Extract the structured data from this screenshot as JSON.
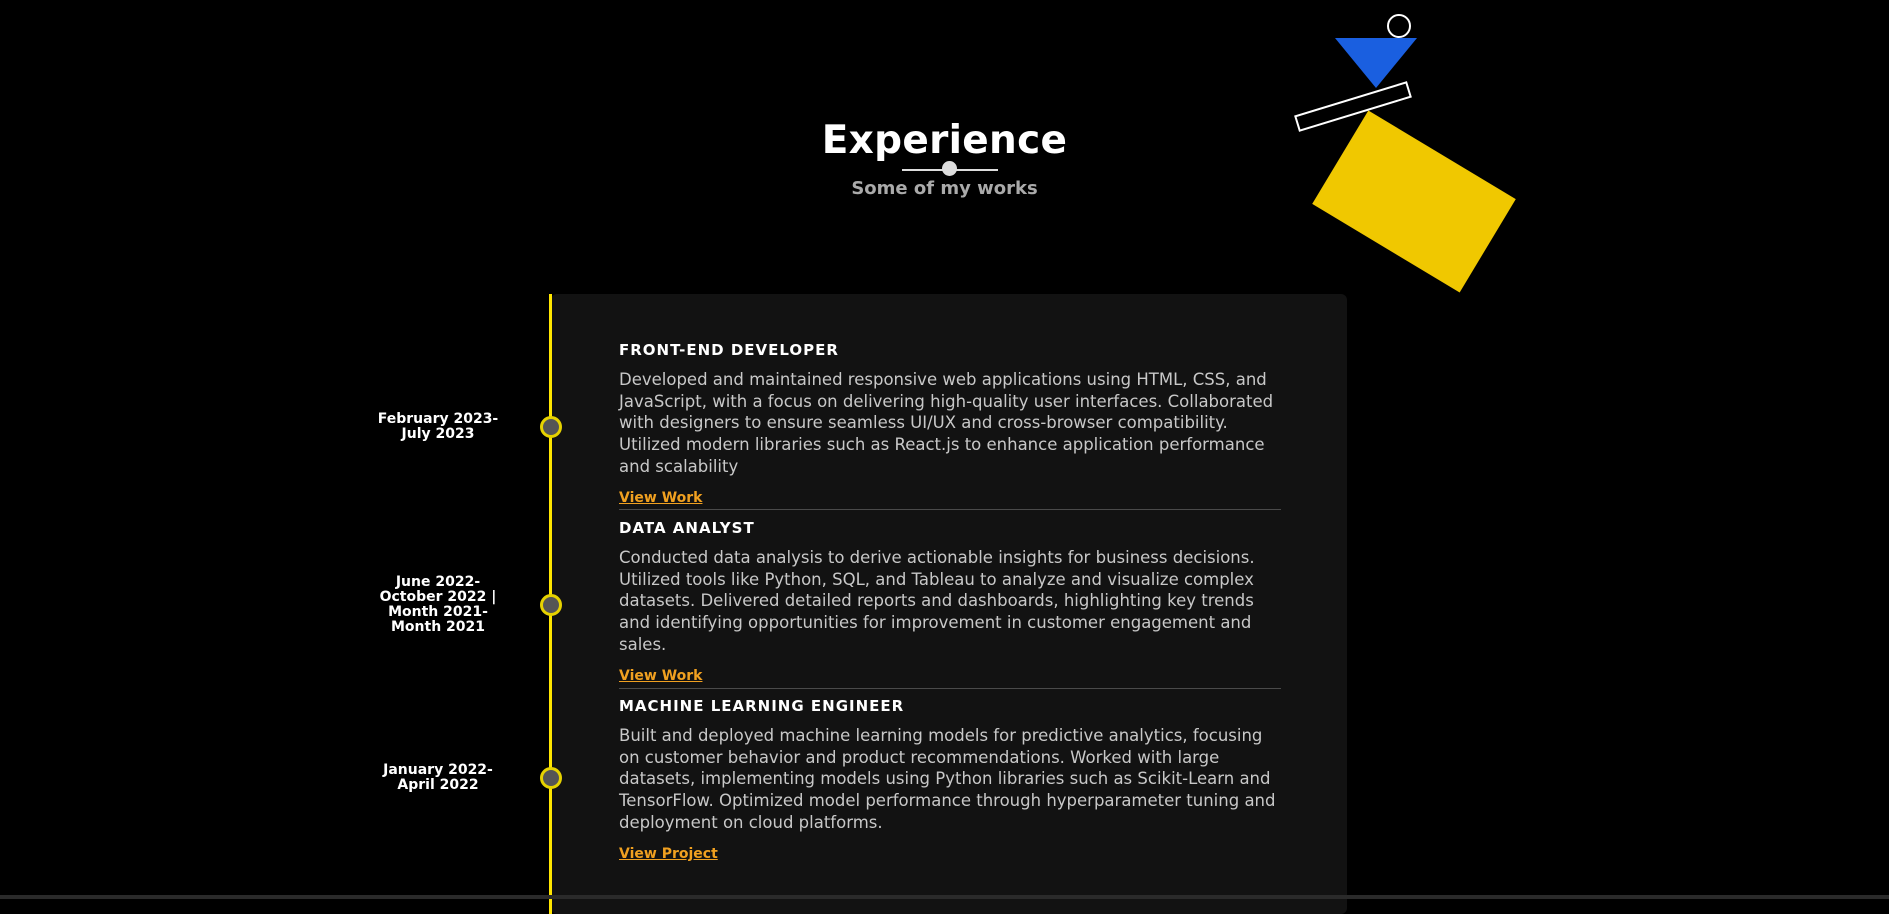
{
  "section": {
    "title": "Experience",
    "subtitle": "Some of my works"
  },
  "colors": {
    "background": "#000000",
    "timeline": "#ffe600",
    "link": "#f0a020",
    "shape_blue": "#1a5fe0",
    "shape_yellow": "#f0c800"
  },
  "experience": [
    {
      "date": "February 2023- July 2023",
      "title": "FRONT-END DEVELOPER",
      "description": "Developed and maintained responsive web applications using HTML, CSS, and JavaScript, with a focus on delivering high-quality user interfaces. Collaborated with designers to ensure seamless UI/UX and cross-browser compatibility. Utilized modern libraries such as React.js to enhance application performance and scalability",
      "link": "View Work"
    },
    {
      "date": "June 2022- October 2022 | Month 2021- Month 2021",
      "title": "DATA ANALYST",
      "description": "Conducted data analysis to derive actionable insights for business decisions. Utilized tools like Python, SQL, and Tableau to analyze and visualize complex datasets. Delivered detailed reports and dashboards, highlighting key trends and identifying opportunities for improvement in customer engagement and sales.",
      "link": "View Work"
    },
    {
      "date": "January 2022- April 2022",
      "title": "MACHINE LEARNING ENGINEER",
      "description": "Built and deployed machine learning models for predictive analytics, focusing on customer behavior and product recommendations. Worked with large datasets, implementing models using Python libraries such as Scikit-Learn and TensorFlow. Optimized model performance through hyperparameter tuning and deployment on cloud platforms.",
      "link": "View Project"
    }
  ]
}
